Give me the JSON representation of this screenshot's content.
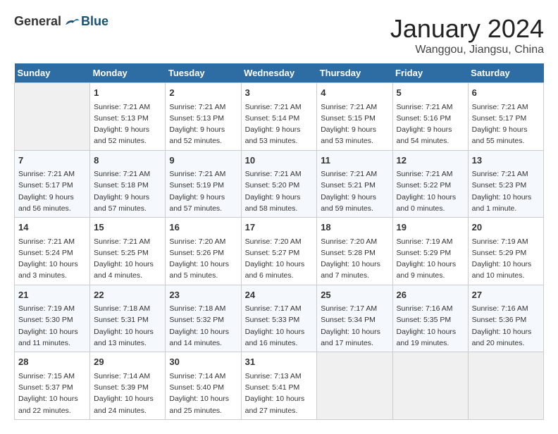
{
  "header": {
    "logo_general": "General",
    "logo_blue": "Blue",
    "title": "January 2024",
    "location": "Wanggou, Jiangsu, China"
  },
  "days_of_week": [
    "Sunday",
    "Monday",
    "Tuesday",
    "Wednesday",
    "Thursday",
    "Friday",
    "Saturday"
  ],
  "weeks": [
    [
      {
        "day": "",
        "sunrise": "",
        "sunset": "",
        "daylight": ""
      },
      {
        "day": "1",
        "sunrise": "Sunrise: 7:21 AM",
        "sunset": "Sunset: 5:13 PM",
        "daylight": "Daylight: 9 hours and 52 minutes."
      },
      {
        "day": "2",
        "sunrise": "Sunrise: 7:21 AM",
        "sunset": "Sunset: 5:13 PM",
        "daylight": "Daylight: 9 hours and 52 minutes."
      },
      {
        "day": "3",
        "sunrise": "Sunrise: 7:21 AM",
        "sunset": "Sunset: 5:14 PM",
        "daylight": "Daylight: 9 hours and 53 minutes."
      },
      {
        "day": "4",
        "sunrise": "Sunrise: 7:21 AM",
        "sunset": "Sunset: 5:15 PM",
        "daylight": "Daylight: 9 hours and 53 minutes."
      },
      {
        "day": "5",
        "sunrise": "Sunrise: 7:21 AM",
        "sunset": "Sunset: 5:16 PM",
        "daylight": "Daylight: 9 hours and 54 minutes."
      },
      {
        "day": "6",
        "sunrise": "Sunrise: 7:21 AM",
        "sunset": "Sunset: 5:17 PM",
        "daylight": "Daylight: 9 hours and 55 minutes."
      }
    ],
    [
      {
        "day": "7",
        "sunrise": "Sunrise: 7:21 AM",
        "sunset": "Sunset: 5:17 PM",
        "daylight": "Daylight: 9 hours and 56 minutes."
      },
      {
        "day": "8",
        "sunrise": "Sunrise: 7:21 AM",
        "sunset": "Sunset: 5:18 PM",
        "daylight": "Daylight: 9 hours and 57 minutes."
      },
      {
        "day": "9",
        "sunrise": "Sunrise: 7:21 AM",
        "sunset": "Sunset: 5:19 PM",
        "daylight": "Daylight: 9 hours and 57 minutes."
      },
      {
        "day": "10",
        "sunrise": "Sunrise: 7:21 AM",
        "sunset": "Sunset: 5:20 PM",
        "daylight": "Daylight: 9 hours and 58 minutes."
      },
      {
        "day": "11",
        "sunrise": "Sunrise: 7:21 AM",
        "sunset": "Sunset: 5:21 PM",
        "daylight": "Daylight: 9 hours and 59 minutes."
      },
      {
        "day": "12",
        "sunrise": "Sunrise: 7:21 AM",
        "sunset": "Sunset: 5:22 PM",
        "daylight": "Daylight: 10 hours and 0 minutes."
      },
      {
        "day": "13",
        "sunrise": "Sunrise: 7:21 AM",
        "sunset": "Sunset: 5:23 PM",
        "daylight": "Daylight: 10 hours and 1 minute."
      }
    ],
    [
      {
        "day": "14",
        "sunrise": "Sunrise: 7:21 AM",
        "sunset": "Sunset: 5:24 PM",
        "daylight": "Daylight: 10 hours and 3 minutes."
      },
      {
        "day": "15",
        "sunrise": "Sunrise: 7:21 AM",
        "sunset": "Sunset: 5:25 PM",
        "daylight": "Daylight: 10 hours and 4 minutes."
      },
      {
        "day": "16",
        "sunrise": "Sunrise: 7:20 AM",
        "sunset": "Sunset: 5:26 PM",
        "daylight": "Daylight: 10 hours and 5 minutes."
      },
      {
        "day": "17",
        "sunrise": "Sunrise: 7:20 AM",
        "sunset": "Sunset: 5:27 PM",
        "daylight": "Daylight: 10 hours and 6 minutes."
      },
      {
        "day": "18",
        "sunrise": "Sunrise: 7:20 AM",
        "sunset": "Sunset: 5:28 PM",
        "daylight": "Daylight: 10 hours and 7 minutes."
      },
      {
        "day": "19",
        "sunrise": "Sunrise: 7:19 AM",
        "sunset": "Sunset: 5:29 PM",
        "daylight": "Daylight: 10 hours and 9 minutes."
      },
      {
        "day": "20",
        "sunrise": "Sunrise: 7:19 AM",
        "sunset": "Sunset: 5:29 PM",
        "daylight": "Daylight: 10 hours and 10 minutes."
      }
    ],
    [
      {
        "day": "21",
        "sunrise": "Sunrise: 7:19 AM",
        "sunset": "Sunset: 5:30 PM",
        "daylight": "Daylight: 10 hours and 11 minutes."
      },
      {
        "day": "22",
        "sunrise": "Sunrise: 7:18 AM",
        "sunset": "Sunset: 5:31 PM",
        "daylight": "Daylight: 10 hours and 13 minutes."
      },
      {
        "day": "23",
        "sunrise": "Sunrise: 7:18 AM",
        "sunset": "Sunset: 5:32 PM",
        "daylight": "Daylight: 10 hours and 14 minutes."
      },
      {
        "day": "24",
        "sunrise": "Sunrise: 7:17 AM",
        "sunset": "Sunset: 5:33 PM",
        "daylight": "Daylight: 10 hours and 16 minutes."
      },
      {
        "day": "25",
        "sunrise": "Sunrise: 7:17 AM",
        "sunset": "Sunset: 5:34 PM",
        "daylight": "Daylight: 10 hours and 17 minutes."
      },
      {
        "day": "26",
        "sunrise": "Sunrise: 7:16 AM",
        "sunset": "Sunset: 5:35 PM",
        "daylight": "Daylight: 10 hours and 19 minutes."
      },
      {
        "day": "27",
        "sunrise": "Sunrise: 7:16 AM",
        "sunset": "Sunset: 5:36 PM",
        "daylight": "Daylight: 10 hours and 20 minutes."
      }
    ],
    [
      {
        "day": "28",
        "sunrise": "Sunrise: 7:15 AM",
        "sunset": "Sunset: 5:37 PM",
        "daylight": "Daylight: 10 hours and 22 minutes."
      },
      {
        "day": "29",
        "sunrise": "Sunrise: 7:14 AM",
        "sunset": "Sunset: 5:39 PM",
        "daylight": "Daylight: 10 hours and 24 minutes."
      },
      {
        "day": "30",
        "sunrise": "Sunrise: 7:14 AM",
        "sunset": "Sunset: 5:40 PM",
        "daylight": "Daylight: 10 hours and 25 minutes."
      },
      {
        "day": "31",
        "sunrise": "Sunrise: 7:13 AM",
        "sunset": "Sunset: 5:41 PM",
        "daylight": "Daylight: 10 hours and 27 minutes."
      },
      {
        "day": "",
        "sunrise": "",
        "sunset": "",
        "daylight": ""
      },
      {
        "day": "",
        "sunrise": "",
        "sunset": "",
        "daylight": ""
      },
      {
        "day": "",
        "sunrise": "",
        "sunset": "",
        "daylight": ""
      }
    ]
  ]
}
